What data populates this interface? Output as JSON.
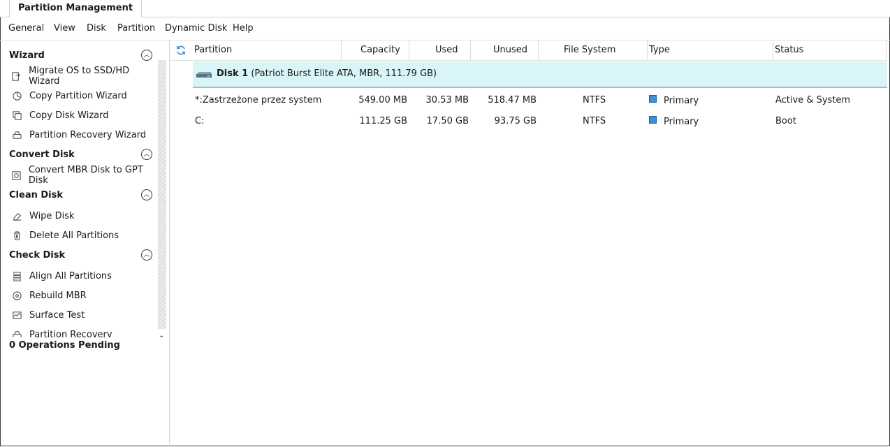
{
  "tab": {
    "label": "Partition Management"
  },
  "menu": [
    "General",
    "View",
    "Disk",
    "Partition",
    "Dynamic Disk",
    "Help"
  ],
  "sidebar": {
    "sections": [
      {
        "title": "Wizard",
        "items": [
          "Migrate OS to SSD/HD Wizard",
          "Copy Partition Wizard",
          "Copy Disk Wizard",
          "Partition Recovery Wizard"
        ]
      },
      {
        "title": "Convert Disk",
        "items": [
          "Convert MBR Disk to GPT Disk"
        ]
      },
      {
        "title": "Clean Disk",
        "items": [
          "Wipe Disk",
          "Delete All Partitions"
        ]
      },
      {
        "title": "Check Disk",
        "items": [
          "Align All Partitions",
          "Rebuild MBR",
          "Surface Test",
          "Partition Recovery"
        ]
      }
    ],
    "ops_pending": "0 Operations Pending"
  },
  "table": {
    "headers": {
      "partition": "Partition",
      "capacity": "Capacity",
      "used": "Used",
      "unused": "Unused",
      "fs": "File System",
      "type": "Type",
      "status": "Status"
    },
    "disk": {
      "name": "Disk 1",
      "details": "(Patriot Burst Elite ATA, MBR, 111.79 GB)"
    },
    "rows": [
      {
        "partition": "*:Zastrzeżone przez system",
        "capacity": "549.00 MB",
        "used": "30.53 MB",
        "unused": "518.47 MB",
        "fs": "NTFS",
        "type": "Primary",
        "status": "Active & System"
      },
      {
        "partition": "C:",
        "capacity": "111.25 GB",
        "used": "17.50 GB",
        "unused": "93.75 GB",
        "fs": "NTFS",
        "type": "Primary",
        "status": "Boot"
      }
    ]
  },
  "colors": {
    "disk_row_bg": "#d9f5f7",
    "primary_swatch": "#3d8fd6"
  }
}
